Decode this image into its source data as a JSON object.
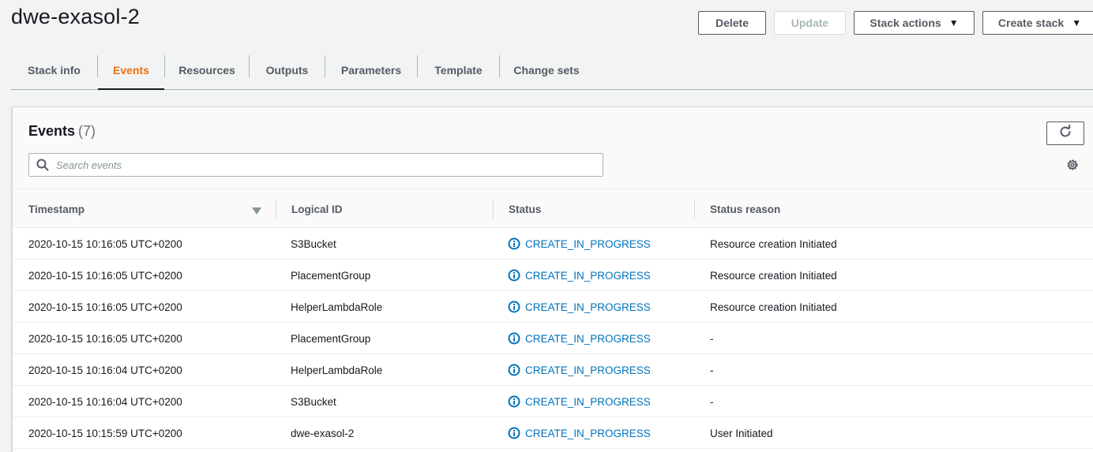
{
  "page": {
    "title": "dwe-exasol-2"
  },
  "actions": {
    "delete_label": "Delete",
    "update_label": "Update",
    "stack_actions_label": "Stack actions",
    "create_stack_label": "Create stack"
  },
  "tabs": [
    {
      "label": "Stack info"
    },
    {
      "label": "Events",
      "active": true
    },
    {
      "label": "Resources"
    },
    {
      "label": "Outputs"
    },
    {
      "label": "Parameters"
    },
    {
      "label": "Template"
    },
    {
      "label": "Change sets"
    }
  ],
  "events": {
    "title": "Events",
    "count": "(7)",
    "search_placeholder": "Search events",
    "columns": [
      "Timestamp",
      "Logical ID",
      "Status",
      "Status reason"
    ],
    "rows": [
      {
        "timestamp": "2020-10-15 10:16:05 UTC+0200",
        "logical_id": "S3Bucket",
        "status": "CREATE_IN_PROGRESS",
        "reason": "Resource creation Initiated"
      },
      {
        "timestamp": "2020-10-15 10:16:05 UTC+0200",
        "logical_id": "PlacementGroup",
        "status": "CREATE_IN_PROGRESS",
        "reason": "Resource creation Initiated"
      },
      {
        "timestamp": "2020-10-15 10:16:05 UTC+0200",
        "logical_id": "HelperLambdaRole",
        "status": "CREATE_IN_PROGRESS",
        "reason": "Resource creation Initiated"
      },
      {
        "timestamp": "2020-10-15 10:16:05 UTC+0200",
        "logical_id": "PlacementGroup",
        "status": "CREATE_IN_PROGRESS",
        "reason": "-"
      },
      {
        "timestamp": "2020-10-15 10:16:04 UTC+0200",
        "logical_id": "HelperLambdaRole",
        "status": "CREATE_IN_PROGRESS",
        "reason": "-"
      },
      {
        "timestamp": "2020-10-15 10:16:04 UTC+0200",
        "logical_id": "S3Bucket",
        "status": "CREATE_IN_PROGRESS",
        "reason": "-"
      },
      {
        "timestamp": "2020-10-15 10:15:59 UTC+0200",
        "logical_id": "dwe-exasol-2",
        "status": "CREATE_IN_PROGRESS",
        "reason": "User Initiated"
      }
    ]
  },
  "colors": {
    "accent": "#ec7211",
    "link": "#0073bb",
    "text": "#16191f",
    "muted": "#545b64"
  },
  "icons": {
    "status": "info-circle-icon",
    "refresh": "refresh-icon",
    "settings": "gear-icon",
    "sort": "sort-down-icon",
    "search": "search-icon"
  }
}
